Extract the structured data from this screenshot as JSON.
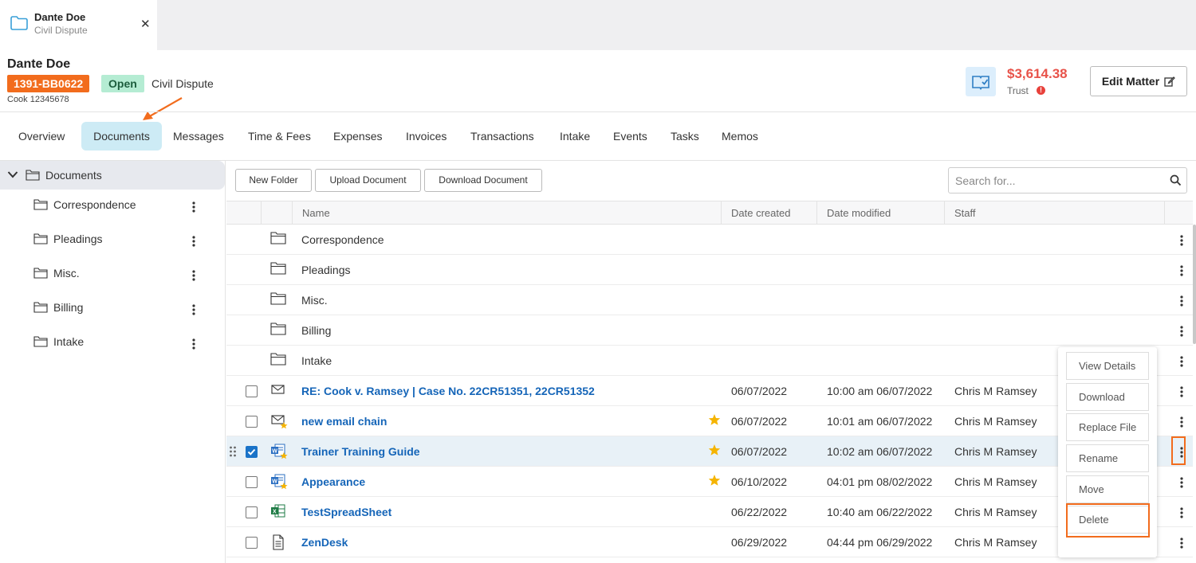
{
  "tab": {
    "client": "Dante Doe",
    "matter_type": "Civil Dispute"
  },
  "matter": {
    "client_name": "Dante Doe",
    "number": "1391-BB0622",
    "status": "Open",
    "type": "Civil Dispute",
    "client_ref": "Cook 12345678",
    "trust_amount": "$3,614.38",
    "trust_label": "Trust",
    "edit_label": "Edit Matter"
  },
  "nav": {
    "tabs": [
      "Overview",
      "Documents",
      "Messages",
      "Time & Fees",
      "Expenses",
      "Invoices",
      "Transactions",
      "Intake",
      "Events",
      "Tasks",
      "Memos"
    ],
    "active": "Documents"
  },
  "sidebar": {
    "root": "Documents",
    "folders": [
      "Correspondence",
      "Pleadings",
      "Misc.",
      "Billing",
      "Intake"
    ]
  },
  "toolbar": {
    "new_folder": "New Folder",
    "upload": "Upload Document",
    "download": "Download Document",
    "search_placeholder": "Search for..."
  },
  "table": {
    "headers": {
      "name": "Name",
      "created": "Date created",
      "modified": "Date modified",
      "staff": "Staff"
    },
    "folders": [
      "Correspondence",
      "Pleadings",
      "Misc.",
      "Billing",
      "Intake"
    ],
    "files": [
      {
        "name": "RE: Cook v. Ramsey | Case No. 22CR51351, 22CR51352",
        "icon": "email-icon",
        "starred": false,
        "checked": false,
        "created": "06/07/2022",
        "modified": "10:00 am 06/07/2022",
        "staff": "Chris M Ramsey"
      },
      {
        "name": "new email chain",
        "icon": "email-icon",
        "starred": true,
        "checked": false,
        "created": "06/07/2022",
        "modified": "10:01 am 06/07/2022",
        "staff": "Chris M Ramsey"
      },
      {
        "name": "Trainer Training Guide",
        "icon": "word-icon",
        "starred": true,
        "checked": true,
        "created": "06/07/2022",
        "modified": "10:02 am 06/07/2022",
        "staff": "Chris M Ramsey"
      },
      {
        "name": "Appearance",
        "icon": "word-icon",
        "starred": true,
        "checked": false,
        "created": "06/10/2022",
        "modified": "04:01 pm 08/02/2022",
        "staff": "Chris M Ramsey"
      },
      {
        "name": "TestSpreadSheet",
        "icon": "excel-icon",
        "starred": false,
        "checked": false,
        "created": "06/22/2022",
        "modified": "10:40 am 06/22/2022",
        "staff": "Chris M Ramsey"
      },
      {
        "name": "ZenDesk",
        "icon": "document-icon",
        "starred": false,
        "checked": false,
        "created": "06/29/2022",
        "modified": "04:44 pm 06/29/2022",
        "staff": "Chris M Ramsey"
      }
    ]
  },
  "context_menu": [
    "View Details",
    "Download",
    "Replace File",
    "Rename",
    "Move",
    "Delete"
  ],
  "colors": {
    "accent_orange": "#f26c1d",
    "link_blue": "#1565b8",
    "trust_red": "#e8534a",
    "open_green": "#b5ecd3",
    "star": "#f5b400"
  }
}
